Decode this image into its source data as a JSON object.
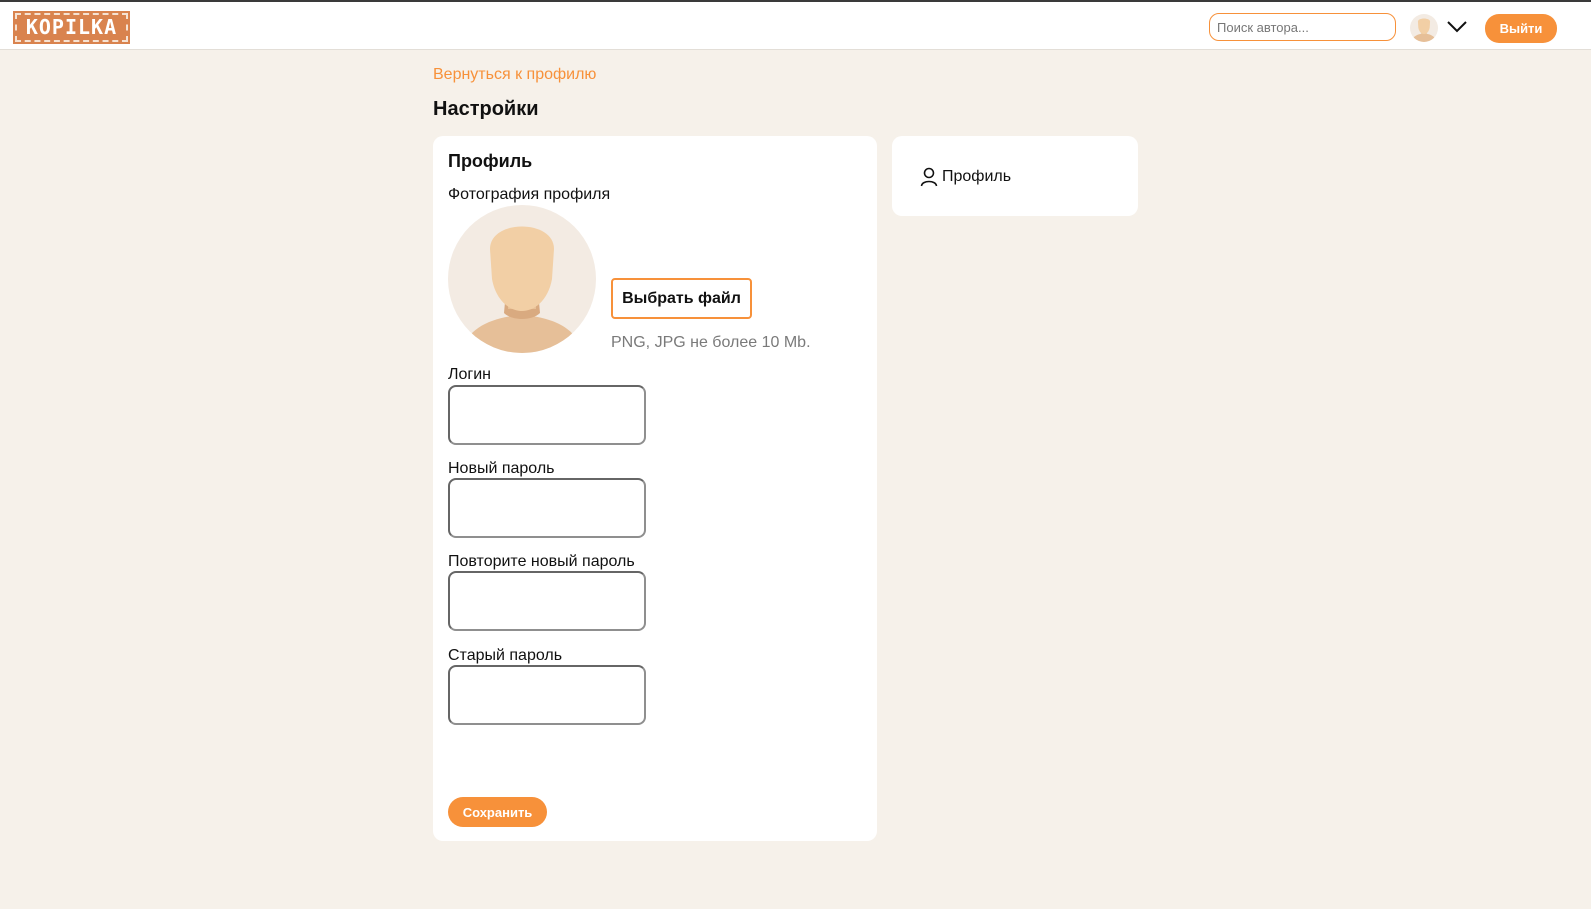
{
  "header": {
    "logo_text": "KOPILKA",
    "search_placeholder": "Поиск автора...",
    "logout_label": "Выйти",
    "accent_color": "#f7913a"
  },
  "page": {
    "back_link": "Вернуться к профилю",
    "title": "Настройки"
  },
  "profile_card": {
    "section_title": "Профиль",
    "photo_label": "Фотография профиля",
    "choose_file_label": "Выбрать файл",
    "file_hint": "PNG, JPG не более 10 Mb.",
    "fields": [
      {
        "label": "Логин",
        "value": ""
      },
      {
        "label": "Новый пароль",
        "value": ""
      },
      {
        "label": "Повторите новый пароль",
        "value": ""
      },
      {
        "label": "Старый пароль",
        "value": ""
      }
    ],
    "save_label": "Сохранить"
  },
  "side_menu": {
    "items": [
      {
        "label": "Профиль",
        "icon": "user-icon"
      }
    ]
  }
}
